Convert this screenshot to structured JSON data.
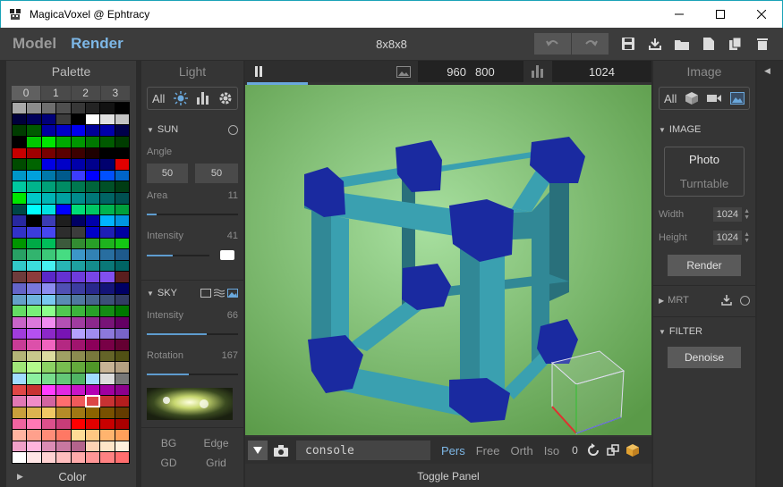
{
  "window": {
    "title": "MagicaVoxel @ Ephtracy"
  },
  "menubar": {
    "mode_model": "Model",
    "mode_render": "Render",
    "doc_title": "8x8x8"
  },
  "palette": {
    "title": "Palette",
    "tabs": [
      "0",
      "1",
      "2",
      "3"
    ],
    "footer_label": "Color",
    "selected_index": 213,
    "rows": [
      [
        "#a9a9a9",
        "#8c8c8c",
        "#6e6e6e",
        "#4f4f4f",
        "#373737",
        "#232323",
        "#121212",
        "#000000"
      ],
      [
        "#00003c",
        "#00005a",
        "#000078",
        "#3c3c3c",
        "#000000",
        "#ffffff",
        "#e1e1e1",
        "#c3c3c3"
      ],
      [
        "#003c00",
        "#005a00",
        "#0000a0",
        "#0000c8",
        "#0000f0",
        "#000096",
        "#0000aa",
        "#00004b"
      ],
      [
        "#000000",
        "#00c800",
        "#00e600",
        "#00aa00",
        "#009600",
        "#007800",
        "#005a00",
        "#003c00"
      ],
      [
        "#c80000",
        "#a00000",
        "#780000",
        "#5a0000",
        "#3c0000",
        "#1e0000",
        "#000000",
        "#000000"
      ],
      [
        "#004b00",
        "#006400",
        "#0000e6",
        "#0000c8",
        "#0000aa",
        "#00008c",
        "#00006e",
        "#e10000"
      ],
      [
        "#0096c8",
        "#00a0dc",
        "#0078aa",
        "#005a8c",
        "#3c3cff",
        "#0000ff",
        "#0050ff",
        "#0064c8"
      ],
      [
        "#00c8a0",
        "#00b48c",
        "#00a078",
        "#008c64",
        "#007850",
        "#00643c",
        "#005028",
        "#003c14"
      ],
      [
        "#00e600",
        "#00c8c8",
        "#00b4b4",
        "#00a0a0",
        "#008c8c",
        "#007878",
        "#006464",
        "#005050"
      ],
      [
        "#004646",
        "#00ffff",
        "#00e1e1",
        "#0000ff",
        "#00dc78",
        "#00c864",
        "#00b450",
        "#00a03c"
      ],
      [
        "#2828a0",
        "#000000",
        "#3c3cb4",
        "#1e1e1e",
        "#000064",
        "#0000aa",
        "#00b4ff",
        "#0096e1"
      ],
      [
        "#3232c8",
        "#3c3cdc",
        "#4646f0",
        "#2d2d2d",
        "#3c3c3c",
        "#0000c8",
        "#1e1eb4",
        "#0000a0"
      ],
      [
        "#009600",
        "#00aa46",
        "#00be5a",
        "#3c5a3c",
        "#328c32",
        "#28a028",
        "#1eb41e",
        "#14c814"
      ],
      [
        "#28a064",
        "#32b46e",
        "#3cc878",
        "#46dc82",
        "#3c96c8",
        "#3282b4",
        "#286ea0",
        "#1e5a8c"
      ],
      [
        "#32c8c8",
        "#3cdcdc",
        "#46f0f0",
        "#28b4b4",
        "#1ea0a0",
        "#148c8c",
        "#0a7878",
        "#006464"
      ],
      [
        "#6e3c3c",
        "#8c3c3c",
        "#5a28c8",
        "#6432d2",
        "#6e3cdc",
        "#7846e6",
        "#8250f0",
        "#5a1e1e"
      ],
      [
        "#6464c8",
        "#7878dc",
        "#8c8cf0",
        "#5050b4",
        "#3c3ca0",
        "#28288c",
        "#141478",
        "#000064"
      ],
      [
        "#64a0c8",
        "#6eb4dc",
        "#78c8f0",
        "#5a8cb4",
        "#5078a0",
        "#46648c",
        "#3c5078",
        "#323c64"
      ],
      [
        "#64dc64",
        "#78f078",
        "#8cff8c",
        "#50c850",
        "#3cb43c",
        "#28a028",
        "#148c14",
        "#007800"
      ],
      [
        "#c864c8",
        "#dc78dc",
        "#f08cf0",
        "#b450b4",
        "#a03ca0",
        "#8c288c",
        "#781478",
        "#640064"
      ],
      [
        "#a03cdc",
        "#b450f0",
        "#8c28c8",
        "#7814b4",
        "#b4a0ff",
        "#a08cf0",
        "#8c78dc",
        "#7864c8"
      ],
      [
        "#c83c96",
        "#dc50aa",
        "#f064be",
        "#b42882",
        "#a0146e",
        "#8c005a",
        "#780046",
        "#640032"
      ],
      [
        "#b4b478",
        "#c8c88c",
        "#dcdca0",
        "#a0a064",
        "#8c8c50",
        "#78783c",
        "#646428",
        "#505014"
      ],
      [
        "#a0e678",
        "#b4fa8c",
        "#8cd264",
        "#78be50",
        "#64aa3c",
        "#509628",
        "#c8b496",
        "#b4a082"
      ],
      [
        "#a0dcff",
        "#8cf0a0",
        "#78dc8c",
        "#64c878",
        "#50b464",
        "#a0dcff",
        "#dcdcdc",
        "#787878"
      ],
      [
        "#e14646",
        "#c83232",
        "#ff3cff",
        "#e128e1",
        "#c814c8",
        "#b400b4",
        "#a000a0",
        "#8c008c"
      ],
      [
        "#e178b4",
        "#f08cc8",
        "#d264a0",
        "#ff6e6e",
        "#f05a5a",
        "#dc4646",
        "#c83232",
        "#b41e1e"
      ],
      [
        "#c8a03c",
        "#dcb450",
        "#f0c864",
        "#b48c28",
        "#a07814",
        "#8c6400",
        "#785000",
        "#643c00"
      ],
      [
        "#f064a0",
        "#ff78b4",
        "#dc508c",
        "#c83c78",
        "#ff0000",
        "#e10000",
        "#c80000",
        "#aa0000"
      ],
      [
        "#ffb4a0",
        "#ffa08c",
        "#ff8c78",
        "#ff7864",
        "#ffdc96",
        "#ffc882",
        "#ffb46e",
        "#ffa05a"
      ],
      [
        "#f0a0c8",
        "#ffb4dc",
        "#dc8cb4",
        "#c878a0",
        "#b4648c",
        "#ffd2b4",
        "#ffe6c8",
        "#fff0dc"
      ],
      [
        "#ffffff",
        "#ffe6e6",
        "#ffd2d2",
        "#ffbebe",
        "#ffaaaa",
        "#ff9696",
        "#ff8282",
        "#ff6e6e"
      ]
    ]
  },
  "light": {
    "title": "Light",
    "filter_all": "All",
    "sun": {
      "label": "SUN",
      "angle_label": "Angle",
      "angle_a": "50",
      "angle_b": "50",
      "area_label": "Area",
      "area_value": "11",
      "area_fraction": 0.11,
      "intensity_label": "Intensity",
      "intensity_value": "41",
      "intensity_fraction": 0.41,
      "color": "#ffffff"
    },
    "sky": {
      "label": "SKY",
      "intensity_label": "Intensity",
      "intensity_value": "66",
      "intensity_fraction": 0.66,
      "rotation_label": "Rotation",
      "rotation_value": "167",
      "rotation_fraction": 0.46
    },
    "bottom_buttons": [
      "BG",
      "Edge",
      "GD",
      "Grid"
    ]
  },
  "viewport": {
    "width": "960",
    "height": "800",
    "samples": "1024",
    "progress_fraction": 0.15,
    "console": "console",
    "projections": [
      "Pers",
      "Free",
      "Orth",
      "Iso"
    ],
    "active_projection": "Pers",
    "counter": "0",
    "toggle_panel": "Toggle Panel",
    "background_center": "#a8e0a0",
    "background_edge": "#5a9a48",
    "voxel_color": "#3aa0b0",
    "edge_voxel_color": "#1a2aa0"
  },
  "image": {
    "title": "Image",
    "filter_all": "All",
    "image_section": "IMAGE",
    "photo": "Photo",
    "turntable": "Turntable",
    "width_label": "Width",
    "width_value": "1024",
    "height_label": "Height",
    "height_value": "1024",
    "render_button": "Render",
    "mrt_label": "MRT",
    "filter_section": "FILTER",
    "denoise_button": "Denoise"
  }
}
